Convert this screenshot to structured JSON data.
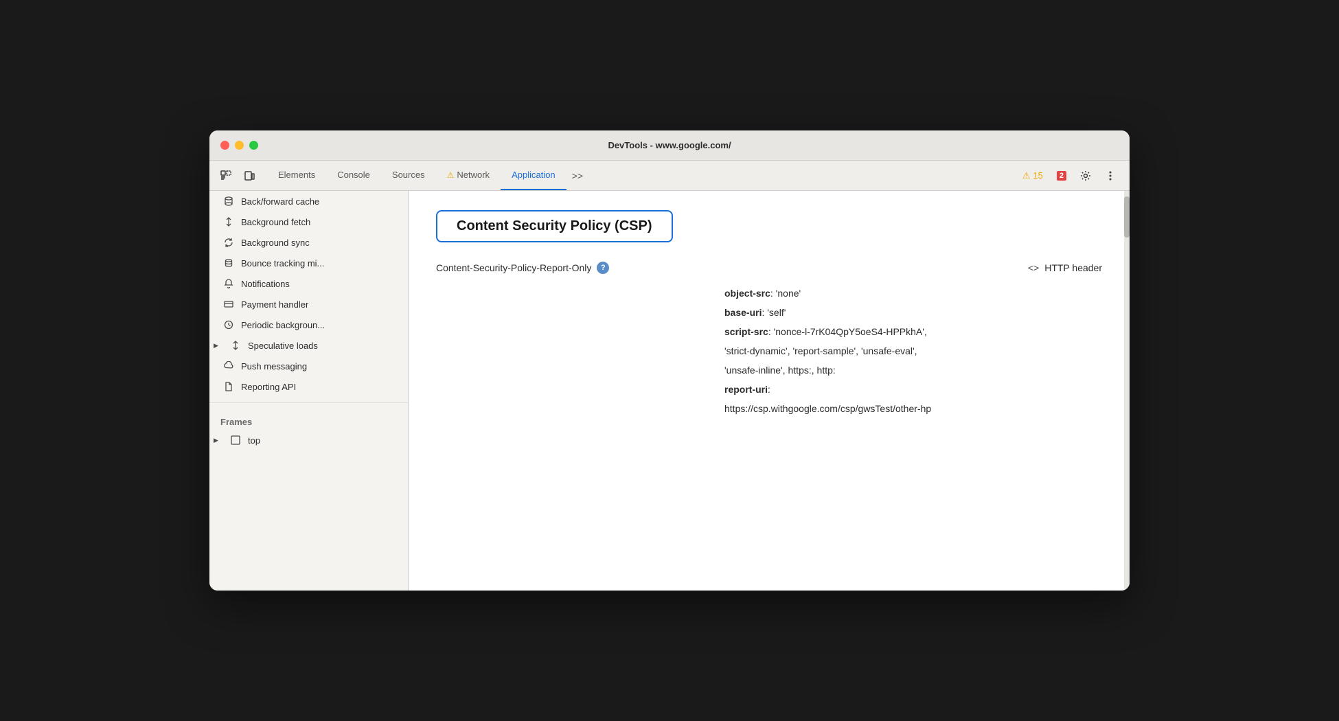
{
  "window": {
    "title": "DevTools - www.google.com/"
  },
  "toolbar": {
    "tabs": [
      {
        "id": "elements",
        "label": "Elements",
        "active": false,
        "warning": false
      },
      {
        "id": "console",
        "label": "Console",
        "active": false,
        "warning": false
      },
      {
        "id": "sources",
        "label": "Sources",
        "active": false,
        "warning": false
      },
      {
        "id": "network",
        "label": "Network",
        "active": false,
        "warning": true
      },
      {
        "id": "application",
        "label": "Application",
        "active": true,
        "warning": false
      }
    ],
    "more_tabs": ">>",
    "warning_count": "15",
    "error_count": "2"
  },
  "sidebar": {
    "items": [
      {
        "id": "back-forward-cache",
        "icon": "cylinder",
        "label": "Back/forward cache",
        "indent": 0
      },
      {
        "id": "background-fetch",
        "icon": "arrows-updown",
        "label": "Background fetch",
        "indent": 0
      },
      {
        "id": "background-sync",
        "icon": "sync",
        "label": "Background sync",
        "indent": 0
      },
      {
        "id": "bounce-tracking",
        "icon": "cylinder",
        "label": "Bounce tracking mi...",
        "indent": 0
      },
      {
        "id": "notifications",
        "icon": "bell",
        "label": "Notifications",
        "indent": 0
      },
      {
        "id": "payment-handler",
        "icon": "card",
        "label": "Payment handler",
        "indent": 0
      },
      {
        "id": "periodic-background",
        "icon": "clock",
        "label": "Periodic backgroun...",
        "indent": 0
      },
      {
        "id": "speculative-loads",
        "icon": "arrows-updown",
        "label": "Speculative loads",
        "indent": 0,
        "has_arrow": true
      },
      {
        "id": "push-messaging",
        "icon": "cloud",
        "label": "Push messaging",
        "indent": 0
      },
      {
        "id": "reporting-api",
        "icon": "document",
        "label": "Reporting API",
        "indent": 0
      }
    ],
    "frames_section": "Frames",
    "frames_item": "top"
  },
  "main": {
    "csp_title": "Content Security Policy (CSP)",
    "policy_name": "Content-Security-Policy-Report-Only",
    "http_header_label": "HTTP header",
    "policy_details": [
      {
        "key": "object-src",
        "value": "'none'"
      },
      {
        "key": "base-uri",
        "value": "'self'"
      },
      {
        "key": "script-src",
        "value": "'nonce-l-7rK04QpY5oeS4-HPPkhA', 'strict-dynamic', 'report-sample', 'unsafe-eval', 'unsafe-inline', https:, http:"
      },
      {
        "key": "report-uri",
        "value": ""
      },
      {
        "uri_value": "https://csp.withgoogle.com/csp/gwsTest/other-hp"
      }
    ]
  }
}
